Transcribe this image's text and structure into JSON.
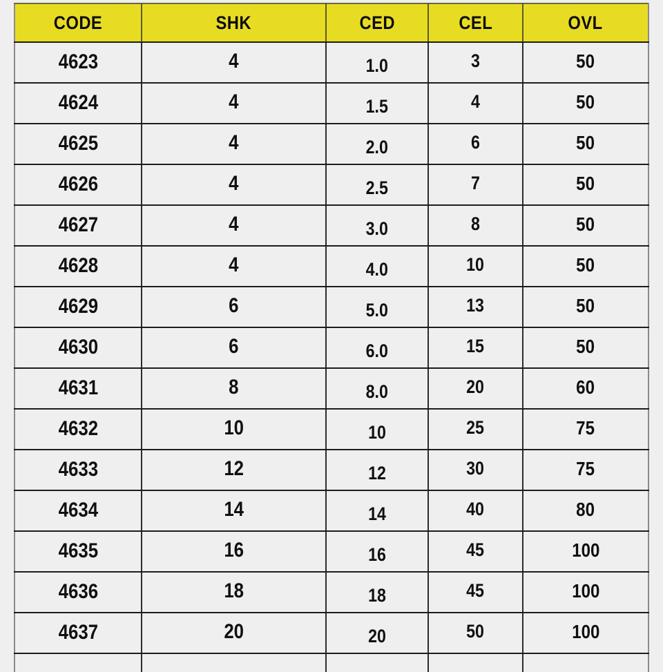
{
  "table": {
    "name": "parameter-code-table",
    "colors": {
      "header_background": "#e8dc23",
      "header_text": "#0d0d0d",
      "cell_background": "#efefef",
      "cell_text": "#101010",
      "grid_line": "#1c1c1c",
      "page_background": "#efefef"
    },
    "columns": [
      {
        "key": "code",
        "label": "CODE"
      },
      {
        "key": "shk",
        "label": "SHK"
      },
      {
        "key": "ced",
        "label": "CED"
      },
      {
        "key": "cel",
        "label": "CEL"
      },
      {
        "key": "ovl",
        "label": "OVL"
      }
    ],
    "rows": [
      {
        "code": "4623",
        "shk": "4",
        "ced": "1.0",
        "cel": "3",
        "ovl": "50"
      },
      {
        "code": "4624",
        "shk": "4",
        "ced": "1.5",
        "cel": "4",
        "ovl": "50"
      },
      {
        "code": "4625",
        "shk": "4",
        "ced": "2.0",
        "cel": "6",
        "ovl": "50"
      },
      {
        "code": "4626",
        "shk": "4",
        "ced": "2.5",
        "cel": "7",
        "ovl": "50"
      },
      {
        "code": "4627",
        "shk": "4",
        "ced": "3.0",
        "cel": "8",
        "ovl": "50"
      },
      {
        "code": "4628",
        "shk": "4",
        "ced": "4.0",
        "cel": "10",
        "ovl": "50"
      },
      {
        "code": "4629",
        "shk": "6",
        "ced": "5.0",
        "cel": "13",
        "ovl": "50"
      },
      {
        "code": "4630",
        "shk": "6",
        "ced": "6.0",
        "cel": "15",
        "ovl": "50"
      },
      {
        "code": "4631",
        "shk": "8",
        "ced": "8.0",
        "cel": "20",
        "ovl": "60"
      },
      {
        "code": "4632",
        "shk": "10",
        "ced": "10",
        "cel": "25",
        "ovl": "75"
      },
      {
        "code": "4633",
        "shk": "12",
        "ced": "12",
        "cel": "30",
        "ovl": "75"
      },
      {
        "code": "4634",
        "shk": "14",
        "ced": "14",
        "cel": "40",
        "ovl": "80"
      },
      {
        "code": "4635",
        "shk": "16",
        "ced": "16",
        "cel": "45",
        "ovl": "100"
      },
      {
        "code": "4636",
        "shk": "18",
        "ced": "18",
        "cel": "45",
        "ovl": "100"
      },
      {
        "code": "4637",
        "shk": "20",
        "ced": "20",
        "cel": "50",
        "ovl": "100"
      }
    ]
  }
}
